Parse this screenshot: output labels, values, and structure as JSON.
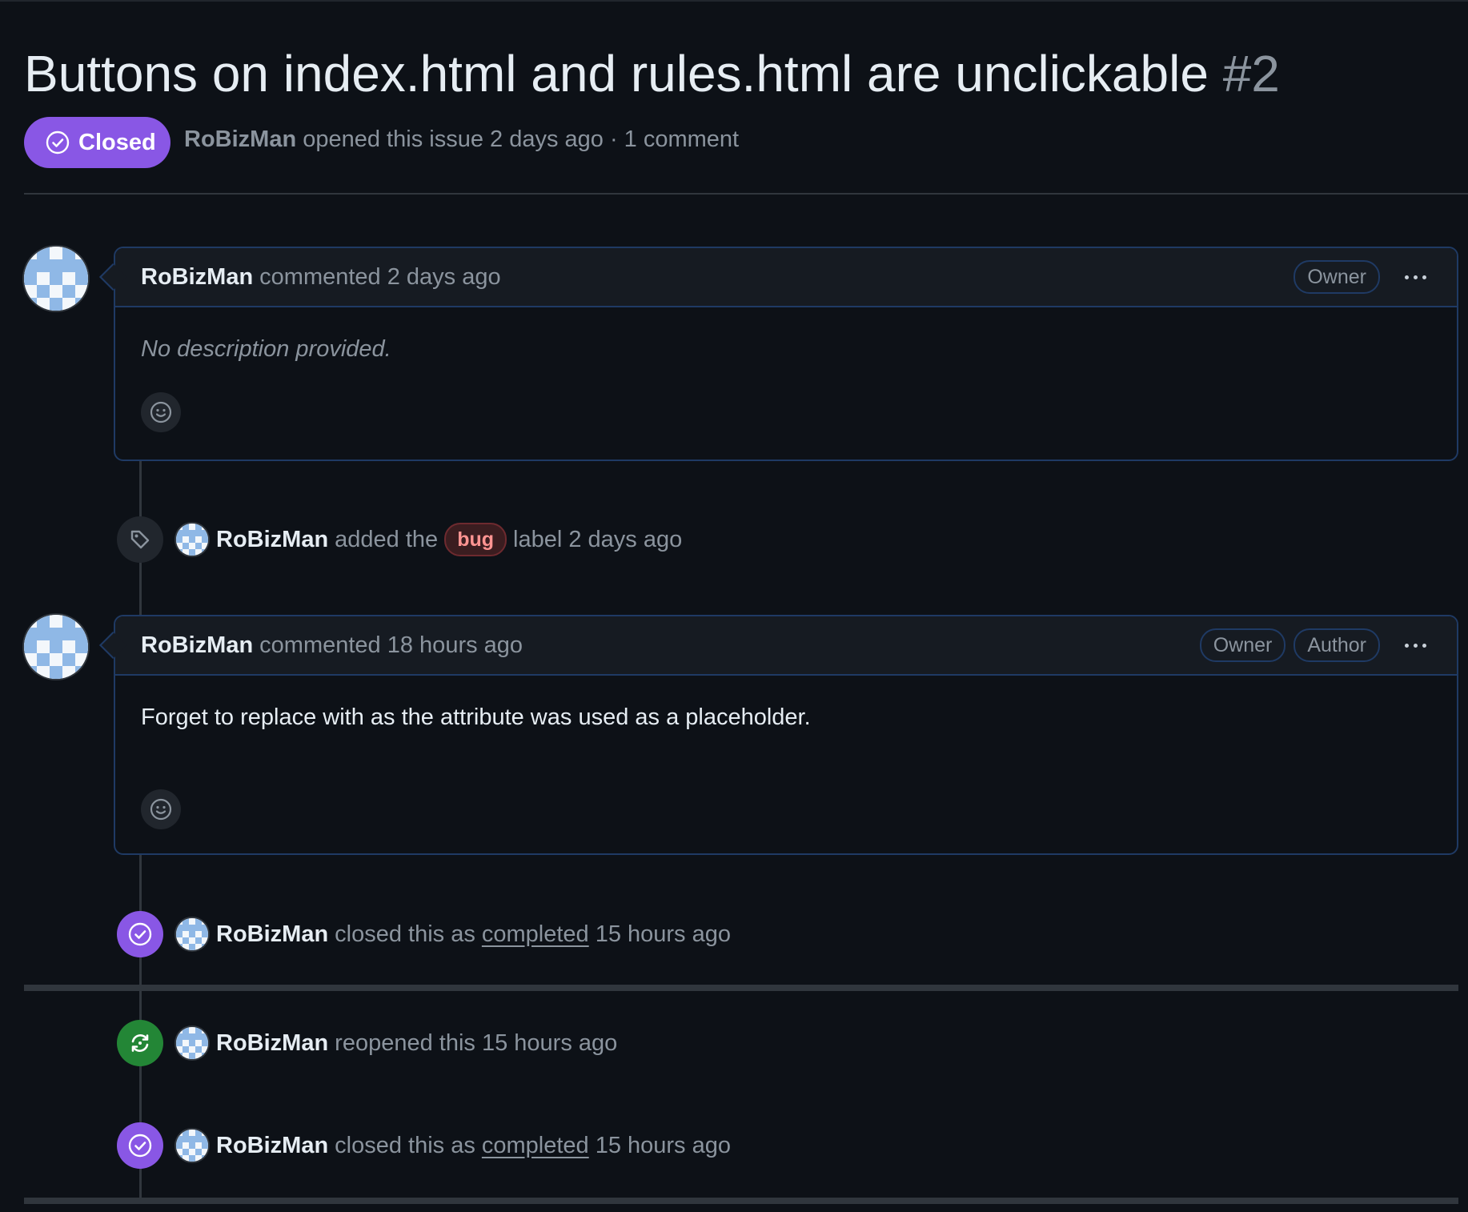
{
  "issue": {
    "title": "Buttons on index.html and rules.html are unclickable",
    "number": "#2",
    "state": "Closed",
    "state_color": "#8957e5",
    "author": "RoBizMan",
    "meta_text": "opened this issue 2 days ago · 1 comment"
  },
  "comments": [
    {
      "author": "RoBizMan",
      "action": "commented 2 days ago",
      "roles": [
        "Owner"
      ],
      "body": "No description provided."
    },
    {
      "author": "RoBizMan",
      "action": "commented 18 hours ago",
      "roles": [
        "Owner",
        "Author"
      ],
      "body": "Forget to replace with as the attribute was used as a placeholder."
    }
  ],
  "events": {
    "label_added": {
      "icon": "tag-icon",
      "actor": "RoBizMan",
      "pre": "added the",
      "label": "bug",
      "post": "label 2 days ago"
    },
    "closed_1": {
      "icon": "check-circle-icon",
      "actor": "RoBizMan",
      "pre": "closed this as",
      "link": "completed",
      "post": "15 hours ago"
    },
    "reopened": {
      "icon": "sync-icon",
      "actor": "RoBizMan",
      "text": "reopened this 15 hours ago"
    },
    "closed_2": {
      "icon": "check-circle-icon",
      "actor": "RoBizMan",
      "pre": "closed this as",
      "link": "completed",
      "post": "15 hours ago"
    }
  },
  "colors": {
    "background": "#0d1117",
    "closed_purple": "#8957e5",
    "reopened_green": "#238636",
    "bug_label": "#ff9492",
    "comment_border": "#1f3a64"
  }
}
